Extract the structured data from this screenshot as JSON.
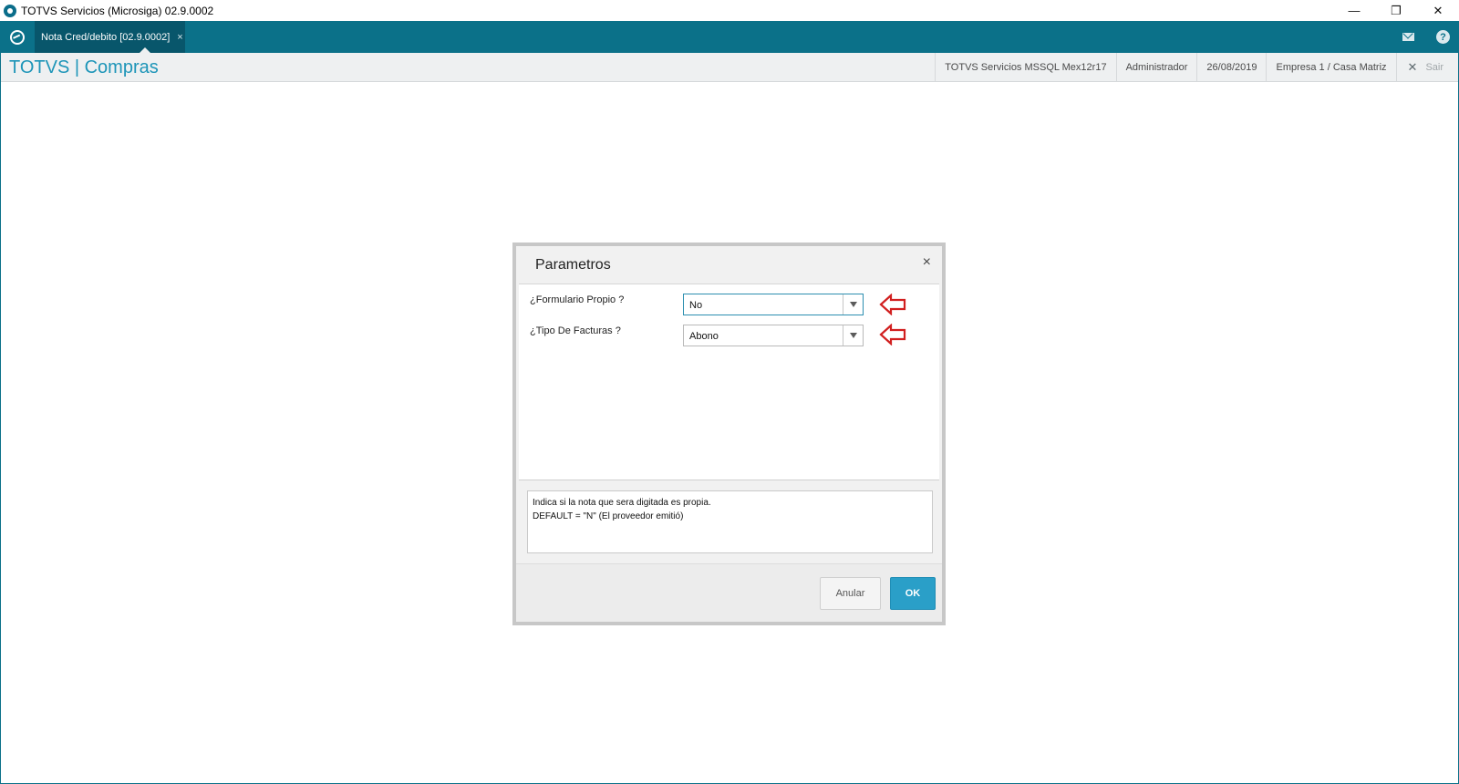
{
  "window": {
    "title": "TOTVS Servicios (Microsiga) 02.9.0002",
    "controls": {
      "minimize": "—",
      "restore": "❐",
      "close": "✕"
    }
  },
  "tabs": [
    {
      "label": "Nota Cred/debito [02.9.0002]",
      "close": "×",
      "active": true
    }
  ],
  "header": {
    "brand": "TOTVS | Compras",
    "environment": "TOTVS Servicios MSSQL Mex12r17",
    "user": "Administrador",
    "date": "26/08/2019",
    "company": "Empresa 1 / Casa Matriz",
    "logout_label": "Sair",
    "logout_icon": "✕"
  },
  "dialog": {
    "title": "Parametros",
    "close": "×",
    "params": [
      {
        "label": "¿Formulario Propio ?",
        "value": "No",
        "focused": true
      },
      {
        "label": "¿Tipo De Facturas ?",
        "value": "Abono",
        "focused": false
      }
    ],
    "help_lines": [
      "Indica si la nota que sera digitada es propia.",
      "DEFAULT = \"N\" (El proveedor emitió)"
    ],
    "cancel_label": "Anular",
    "ok_label": "OK"
  },
  "colors": {
    "accent": "#0b7189",
    "brand_text": "#1d95b8",
    "ok_button": "#2a9fc8",
    "indicator_arrow": "#d11f1f"
  }
}
